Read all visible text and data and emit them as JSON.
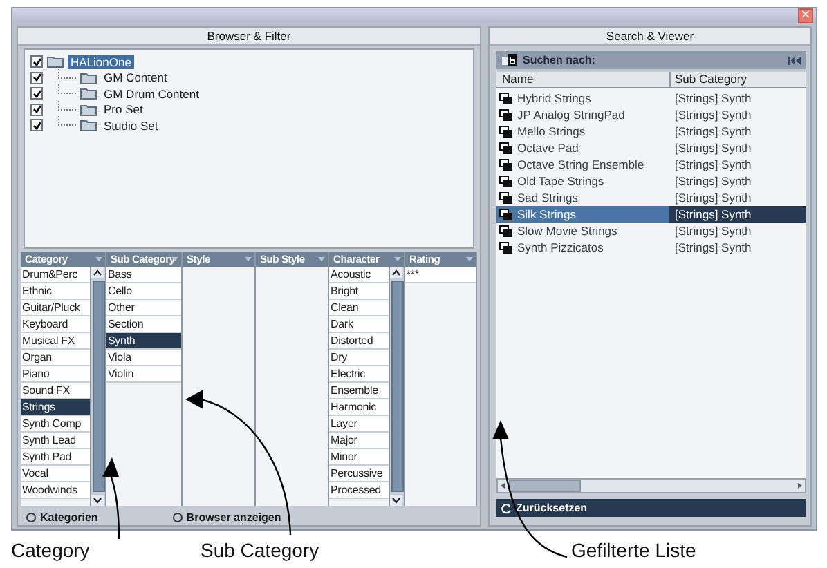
{
  "window": {
    "close": "×"
  },
  "browser_filter": {
    "title": "Browser & Filter",
    "tree": [
      {
        "label": "HALionOne",
        "checked": true,
        "selected": true,
        "children": [
          {
            "label": "GM Content",
            "checked": true,
            "selected": false
          },
          {
            "label": "GM Drum Content",
            "checked": true,
            "selected": false
          },
          {
            "label": "Pro Set",
            "checked": true,
            "selected": false
          },
          {
            "label": "Studio Set",
            "checked": true,
            "selected": false
          }
        ]
      }
    ],
    "filter_columns": [
      {
        "header": "Category",
        "scrollbar": true,
        "items": [
          {
            "label": "Drum&Perc",
            "selected": false
          },
          {
            "label": "Ethnic",
            "selected": false
          },
          {
            "label": "Guitar/Pluck",
            "selected": false
          },
          {
            "label": "Keyboard",
            "selected": false
          },
          {
            "label": "Musical FX",
            "selected": false
          },
          {
            "label": "Organ",
            "selected": false
          },
          {
            "label": "Piano",
            "selected": false
          },
          {
            "label": "Sound FX",
            "selected": false
          },
          {
            "label": "Strings",
            "selected": true
          },
          {
            "label": "Synth Comp",
            "selected": false
          },
          {
            "label": "Synth Lead",
            "selected": false
          },
          {
            "label": "Synth Pad",
            "selected": false
          },
          {
            "label": "Vocal",
            "selected": false
          },
          {
            "label": "Woodwinds",
            "selected": false
          }
        ]
      },
      {
        "header": "Sub Category",
        "scrollbar": false,
        "items": [
          {
            "label": "Bass",
            "selected": false
          },
          {
            "label": "Cello",
            "selected": false
          },
          {
            "label": "Other",
            "selected": false
          },
          {
            "label": "Section",
            "selected": false
          },
          {
            "label": "Synth",
            "selected": true
          },
          {
            "label": "Viola",
            "selected": false
          },
          {
            "label": "Violin",
            "selected": false
          }
        ]
      },
      {
        "header": "Style",
        "scrollbar": false
      },
      {
        "header": "Sub Style",
        "scrollbar": false
      },
      {
        "header": "Character",
        "scrollbar": true,
        "items": [
          {
            "label": "Acoustic",
            "selected": false
          },
          {
            "label": "Bright",
            "selected": false
          },
          {
            "label": "Clean",
            "selected": false
          },
          {
            "label": "Dark",
            "selected": false
          },
          {
            "label": "Distorted",
            "selected": false
          },
          {
            "label": "Dry",
            "selected": false
          },
          {
            "label": "Electric",
            "selected": false
          },
          {
            "label": "Ensemble",
            "selected": false
          },
          {
            "label": "Harmonic",
            "selected": false
          },
          {
            "label": "Layer",
            "selected": false
          },
          {
            "label": "Major",
            "selected": false
          },
          {
            "label": "Minor",
            "selected": false
          },
          {
            "label": "Percussive",
            "selected": false
          },
          {
            "label": "Processed",
            "selected": false
          }
        ]
      },
      {
        "header": "Rating",
        "scrollbar": false,
        "items": [
          {
            "label": "***",
            "selected": false
          }
        ]
      }
    ],
    "options": [
      {
        "label": "Kategorien",
        "selected": false
      },
      {
        "label": "Browser anzeigen",
        "selected": false
      }
    ]
  },
  "search_viewer": {
    "title": "Search & Viewer",
    "search_label": "Suchen nach:",
    "columns": [
      "Name",
      "Sub Category"
    ],
    "rows": [
      {
        "name": "Hybrid Strings",
        "sub_category": "[Strings] Synth",
        "selected": false
      },
      {
        "name": "JP Analog StringPad",
        "sub_category": "[Strings] Synth",
        "selected": false
      },
      {
        "name": "Mello Strings",
        "sub_category": "[Strings] Synth",
        "selected": false
      },
      {
        "name": "Octave Pad",
        "sub_category": "[Strings] Synth",
        "selected": false
      },
      {
        "name": "Octave String Ensemble",
        "sub_category": "[Strings] Synth",
        "selected": false
      },
      {
        "name": "Old Tape Strings",
        "sub_category": "[Strings] Synth",
        "selected": false
      },
      {
        "name": "Sad Strings",
        "sub_category": "[Strings] Synth",
        "selected": false
      },
      {
        "name": "Silk Strings",
        "sub_category": "[Strings] Synth",
        "selected": true
      },
      {
        "name": "Slow Movie Strings",
        "sub_category": "[Strings] Synth",
        "selected": false
      },
      {
        "name": "Synth Pizzicatos",
        "sub_category": "[Strings] Synth",
        "selected": false
      }
    ],
    "reset": "Zurücksetzen"
  },
  "callouts": [
    "Category",
    "Sub Category",
    "Gefilterte Liste"
  ]
}
